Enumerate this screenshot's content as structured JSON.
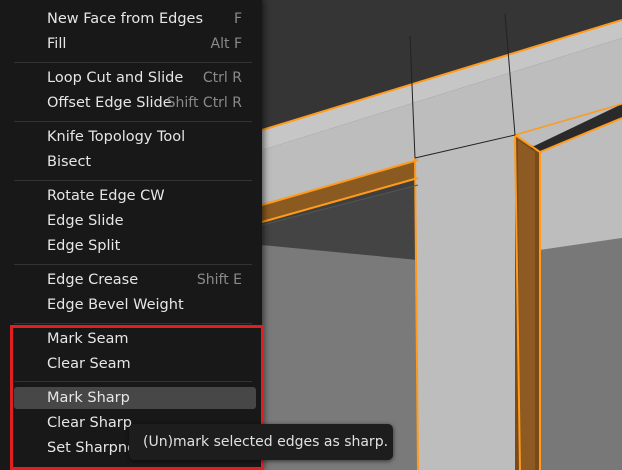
{
  "menu": {
    "items": [
      {
        "label": "New Face from Edges",
        "shortcut": "F"
      },
      {
        "label": "Fill",
        "shortcut": "Alt F"
      },
      {
        "label": "Loop Cut and Slide",
        "shortcut": "Ctrl R"
      },
      {
        "label": "Offset Edge Slide",
        "shortcut": "Shift Ctrl R"
      },
      {
        "label": "Knife Topology Tool",
        "shortcut": ""
      },
      {
        "label": "Bisect",
        "shortcut": ""
      },
      {
        "label": "Rotate Edge CW",
        "shortcut": ""
      },
      {
        "label": "Edge Slide",
        "shortcut": ""
      },
      {
        "label": "Edge Split",
        "shortcut": ""
      },
      {
        "label": "Edge Crease",
        "shortcut": "Shift E"
      },
      {
        "label": "Edge Bevel Weight",
        "shortcut": ""
      },
      {
        "label": "Mark Seam",
        "shortcut": ""
      },
      {
        "label": "Clear Seam",
        "shortcut": ""
      },
      {
        "label": "Mark Sharp",
        "shortcut": ""
      },
      {
        "label": "Clear Sharp",
        "shortcut": ""
      },
      {
        "label": "Set Sharpness",
        "shortcut": ""
      }
    ]
  },
  "tooltip": {
    "text": "(Un)mark selected edges as sharp."
  },
  "colors": {
    "selected_edge": "#ff9a1a",
    "highlight": "#e02020"
  }
}
